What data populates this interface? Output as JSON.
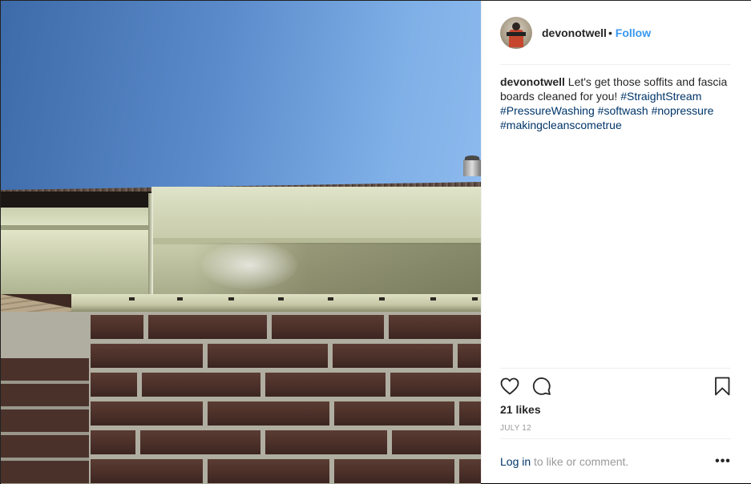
{
  "post": {
    "username": "devonotwell",
    "separator": "•",
    "follow_label": "Follow",
    "caption_user": "devonotwell",
    "caption_text": "Let's get those soffits and fascia boards cleaned for you!",
    "hashtags": [
      "#StraightStream",
      "#PressureWashing",
      "#softwash",
      "#nopressure",
      "#makingcleanscometrue"
    ],
    "likes": "21 likes",
    "date": "JULY 12",
    "login_link": "Log in",
    "login_suffix": "to like or comment.",
    "more_label": "•••"
  },
  "colors": {
    "link_blue": "#3897f0",
    "hashtag_navy": "#003569",
    "text_dark": "#262626",
    "muted_gray": "#999999",
    "divider": "#efefef"
  },
  "icons": {
    "like": "heart-icon",
    "comment": "comment-icon",
    "save": "bookmark-icon",
    "more": "more-options-icon"
  }
}
